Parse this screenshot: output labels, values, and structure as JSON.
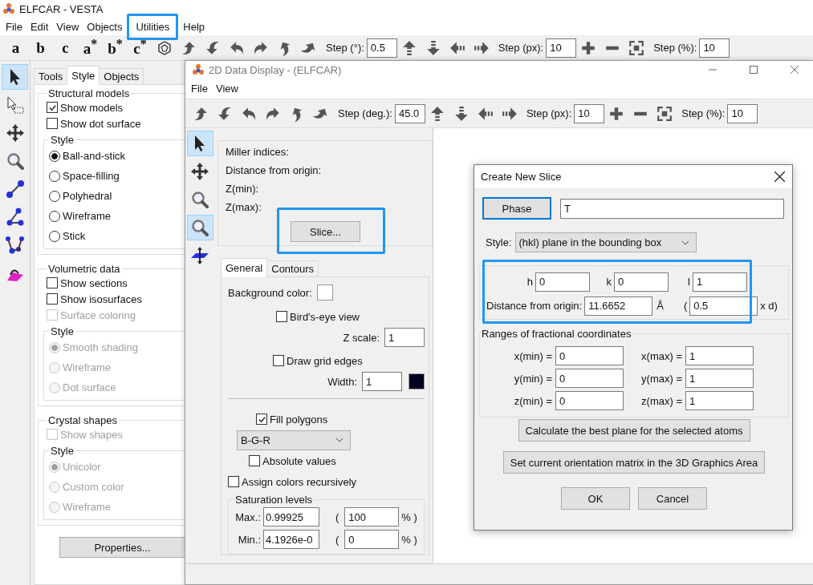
{
  "main": {
    "title": "ELFCAR - VESTA",
    "menu": [
      {
        "label": "File",
        "highlighted": false
      },
      {
        "label": "Edit",
        "highlighted": false
      },
      {
        "label": "View",
        "highlighted": false
      },
      {
        "label": "Objects",
        "highlighted": false
      },
      {
        "label": "Utilities",
        "highlighted": true
      },
      {
        "label": "Help",
        "highlighted": false
      }
    ],
    "axes": [
      "a",
      "b",
      "c",
      "a$^{*}$",
      "b$^{*}$",
      "c$^{*}$"
    ],
    "steps": [
      {
        "label": "Step (°):",
        "value": "0.5"
      },
      {
        "label": "Step (px):",
        "value": "10"
      },
      {
        "label": "Step (%):",
        "value": "10"
      }
    ],
    "tools": [
      {
        "kind": "select",
        "selected": true
      },
      {
        "kind": "region",
        "selected": false
      },
      {
        "kind": "move",
        "selected": false
      },
      {
        "kind": "zoom",
        "selected": false
      },
      {
        "kind": "distance",
        "selected": false
      },
      {
        "kind": "angle",
        "selected": false
      },
      {
        "kind": "dihedral",
        "selected": false
      },
      {
        "kind": "plane",
        "selected": false
      }
    ],
    "tabs": [
      {
        "label": "Tools",
        "selected": false
      },
      {
        "label": "Style",
        "selected": true
      },
      {
        "label": "Objects",
        "selected": false
      }
    ],
    "groups": [
      {
        "title": "Structural models",
        "checks": [
          {
            "label": "Show models",
            "checked": true,
            "disabled": false
          },
          {
            "label": "Show dot surface",
            "checked": false,
            "disabled": false
          }
        ],
        "style_title": "Style",
        "options": [
          {
            "label": "Ball-and-stick",
            "selected": true,
            "disabled": false
          },
          {
            "label": "Space-filling",
            "selected": false,
            "disabled": false
          },
          {
            "label": "Polyhedral",
            "selected": false,
            "disabled": false
          },
          {
            "label": "Wireframe",
            "selected": false,
            "disabled": false
          },
          {
            "label": "Stick",
            "selected": false,
            "disabled": false
          }
        ]
      },
      {
        "title": "Volumetric data",
        "checks": [
          {
            "label": "Show sections",
            "checked": false,
            "disabled": false
          },
          {
            "label": "Show isosurfaces",
            "checked": false,
            "disabled": false
          },
          {
            "label": "Surface coloring",
            "checked": false,
            "disabled": true
          }
        ],
        "style_title": "Style",
        "options": [
          {
            "label": "Smooth shading",
            "selected": true,
            "disabled": true
          },
          {
            "label": "Wireframe",
            "selected": false,
            "disabled": true
          },
          {
            "label": "Dot surface",
            "selected": false,
            "disabled": true
          }
        ]
      },
      {
        "title": "Crystal shapes",
        "checks": [
          {
            "label": "Show shapes",
            "checked": false,
            "disabled": true
          }
        ],
        "style_title": "Style",
        "options": [
          {
            "label": "Unicolor",
            "selected": true,
            "disabled": true
          },
          {
            "label": "Custom color",
            "selected": false,
            "disabled": true
          },
          {
            "label": "Wireframe",
            "selected": false,
            "disabled": true
          }
        ]
      }
    ],
    "properties_button": "Properties..."
  },
  "data_window": {
    "title": "2D Data Display - (ELFCAR)",
    "menu": [
      "File",
      "View"
    ],
    "steps": [
      {
        "label": "Step (deg.):",
        "value": "45.0"
      },
      {
        "label": "Step (px):",
        "value": "10"
      },
      {
        "label": "Step (%):",
        "value": "10"
      }
    ],
    "tools": [
      {
        "kind": "select",
        "selected": true
      },
      {
        "kind": "move",
        "selected": false
      },
      {
        "kind": "zoom",
        "selected": false
      },
      {
        "kind": "zoom",
        "selected": true
      },
      {
        "kind": "slice",
        "selected": false
      }
    ],
    "info": [
      "Miller indices:",
      "Distance from origin:",
      "Z(min):",
      "Z(max):"
    ],
    "slice_button": {
      "label": "Slice...",
      "highlighted": true
    },
    "tabs": [
      {
        "label": "General",
        "selected": true
      },
      {
        "label": "Contours",
        "selected": false
      }
    ],
    "general": {
      "background_label": "Background color:",
      "birds_eye": {
        "label": "Bird's-eye view",
        "checked": false
      },
      "z_scale": {
        "label": "Z scale:",
        "value": "1"
      },
      "grid_edges": {
        "label": "Draw grid edges",
        "checked": false
      },
      "width": {
        "label": "Width:",
        "value": "1"
      },
      "fill_polygons": {
        "label": "Fill polygons",
        "checked": true
      },
      "colormap": "B-G-R",
      "absolute_values": {
        "label": "Absolute values",
        "checked": false
      },
      "assign_recursively": {
        "label": "Assign colors recursively",
        "checked": false
      },
      "saturation": {
        "title": "Saturation levels",
        "rows": [
          {
            "label": "Max.:",
            "value": "0.99925",
            "open": "(",
            "percent": "100",
            "unit": "% )"
          },
          {
            "label": "Min.:",
            "value": "4.1926e-0",
            "open": "(",
            "percent": "0",
            "unit": "% )"
          }
        ]
      }
    }
  },
  "dialog": {
    "title": "Create New Slice",
    "phase_button": "Phase",
    "phase": "T",
    "style_label": "Style:",
    "style": "(hkl) plane in the bounding box",
    "hkl": [
      {
        "label": "h",
        "value": "0"
      },
      {
        "label": "k",
        "value": "0"
      },
      {
        "label": "l",
        "value": "1"
      }
    ],
    "hkl_highlighted": true,
    "distance": {
      "label": "Distance from origin:",
      "value": "11.6652",
      "unit": "Å",
      "open": "(",
      "factor": "0.5",
      "suffix": "x d)"
    },
    "ranges": {
      "title": "Ranges of fractional coordinates",
      "fields": [
        {
          "label": "x(min) =",
          "value": "0"
        },
        {
          "label": "x(max) =",
          "value": "1"
        },
        {
          "label": "y(min) =",
          "value": "0"
        },
        {
          "label": "y(max) =",
          "value": "1"
        },
        {
          "label": "z(min) =",
          "value": "0"
        },
        {
          "label": "z(max) =",
          "value": "1"
        }
      ]
    },
    "buttons": [
      "Calculate the best plane for the selected atoms",
      "Set current orientation matrix in the 3D Graphics Area"
    ],
    "ok": "OK",
    "cancel": "Cancel"
  }
}
